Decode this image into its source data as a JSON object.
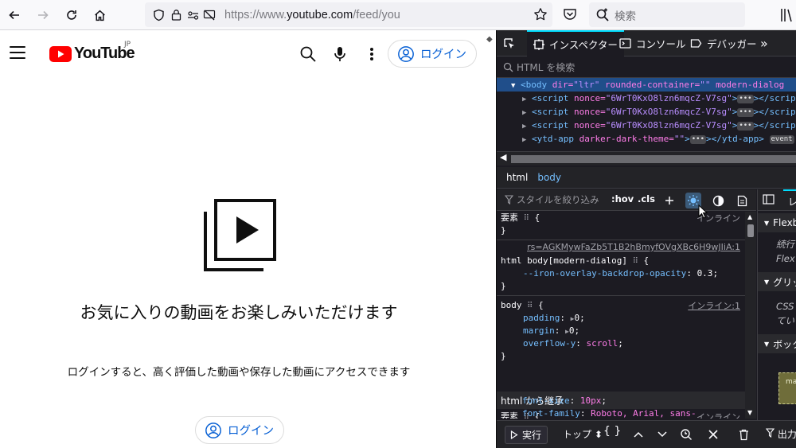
{
  "browser": {
    "url_prefix": "https://www.",
    "url_host": "youtube.com",
    "url_path": "/feed/you",
    "search_placeholder": "検索"
  },
  "youtube": {
    "logo_text": "YouTube",
    "region": "JP",
    "login_label": "ログイン",
    "empty_title": "お気に入りの動画をお楽しみいただけます",
    "empty_desc": "ログインすると、高く評価した動画や保存した動画にアクセスできます",
    "bottom_login_label": "ログイン"
  },
  "devtools": {
    "tabs": [
      {
        "label": "インスペクター"
      },
      {
        "label": "コンソール"
      },
      {
        "label": "デバッガー"
      }
    ],
    "html_search_placeholder": "HTML を検索",
    "markup_lines": [
      {
        "open": "<body",
        "a1": " dir=",
        "v1": "\"ltr\"",
        "a2": " rounded-container=",
        "v2": "\"\"",
        "a3": " modern-dialog",
        "tail": ""
      },
      {
        "open": "<script",
        "a1": " nonce=",
        "v1": "\"6WrT0KxO8lzn6mqcZ-V7sg\"",
        "close": "></script"
      },
      {
        "open": "<script",
        "a1": " nonce=",
        "v1": "\"6WrT0KxO8lzn6mqcZ-V7sg\"",
        "close": "></script"
      },
      {
        "open": "<script",
        "a1": " nonce=",
        "v1": "\"6WrT0KxO8lzn6mqcZ-V7sg\"",
        "close": "></script"
      },
      {
        "open": "<ytd-app",
        "a1": " darker-dark-theme=",
        "v1": "\"\"",
        "close": "></ytd-app>",
        "badge": "event"
      }
    ],
    "breadcrumb": [
      "html",
      "body"
    ],
    "rules_filter_placeholder": "スタイルを絞り込み",
    "hov_label": ":hov",
    "cls_label": ".cls",
    "rules": {
      "element_label": "要素",
      "element_source": "インライン",
      "rule1_source": "rs=AGKMywFaZb5T1B2hBmyfOVgXBc6H9wJIiA:1",
      "rule1_selector": "html body[modern-dialog]",
      "rule1_prop": "--iron-overlay-backdrop-opacity",
      "rule1_value": "0.3",
      "rule2_selector": "body",
      "rule2_source": "インライン:1",
      "rule2_props": [
        {
          "name": "padding",
          "value": "0",
          "expand": true
        },
        {
          "name": "margin",
          "value": "0",
          "expand": true
        },
        {
          "name": "overflow-y",
          "value": "scroll",
          "expand": false
        }
      ],
      "inherit_header": "html から継承",
      "inherit_element_label": "要素",
      "inherit_source": "インライン",
      "inherit_props": [
        {
          "name": "font-size",
          "value": "10px"
        },
        {
          "name": "font-family",
          "value": "Roboto, Arial, sans-"
        }
      ]
    },
    "side_panel": {
      "tab_label": "レ",
      "sections": [
        "Flexb",
        "グリッ",
        "ボック"
      ],
      "flex_note_1": "続行",
      "flex_note_2": "Flex",
      "grid_note_1": "CSS",
      "grid_note_2": "てい",
      "box_label": "ma"
    },
    "console": {
      "run_label": "実行",
      "context_label": "トップ",
      "braces_label": "{ }",
      "filter_label": "出力"
    }
  },
  "colors": {
    "youtube_red": "#ff0000",
    "link_blue": "#065fd4",
    "devtools_bg": "#1c1b22",
    "devtools_selection": "#204e8a"
  }
}
